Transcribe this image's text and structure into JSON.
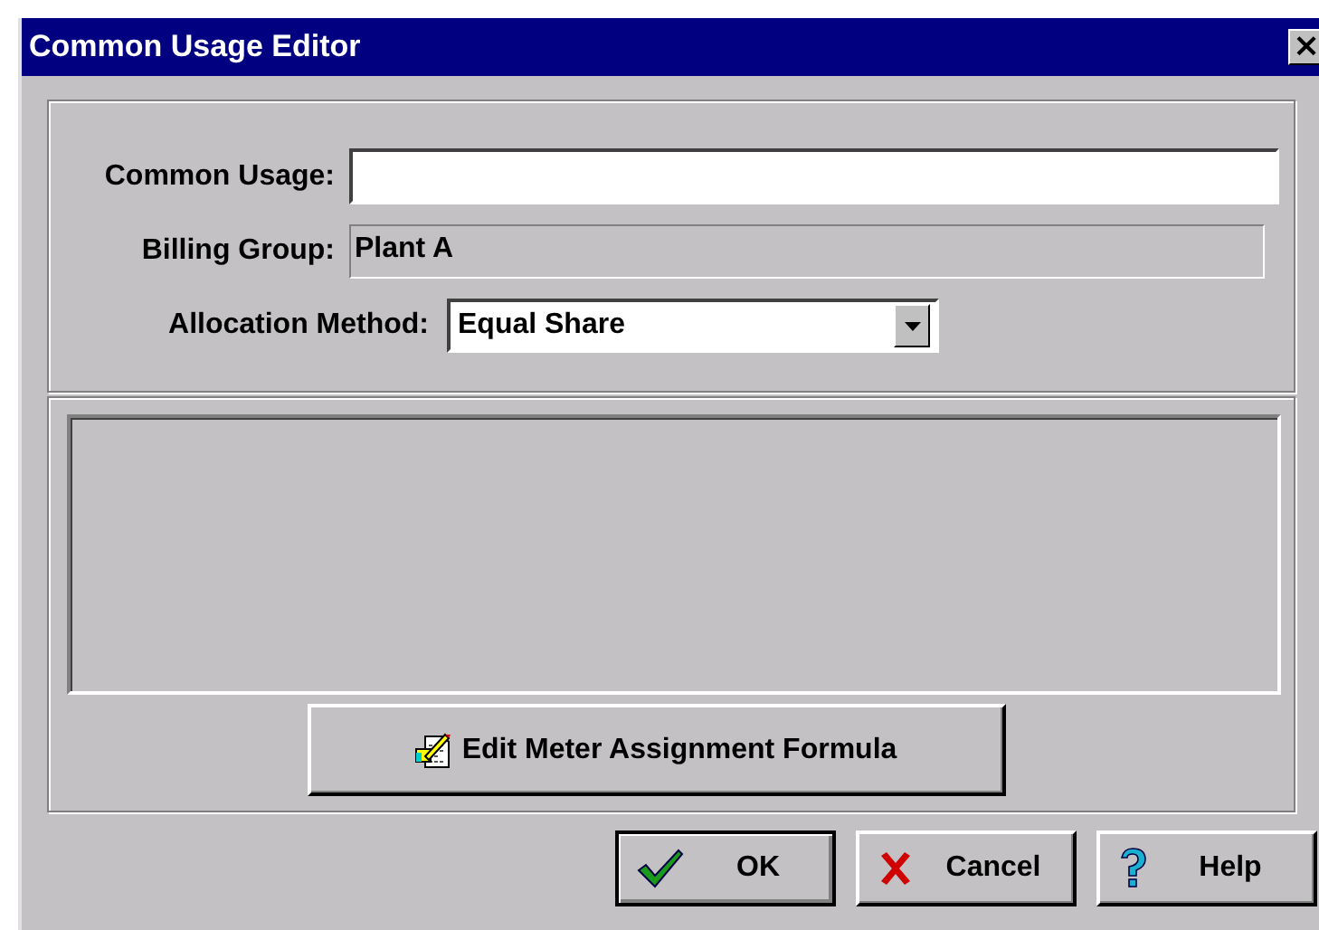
{
  "window": {
    "title": "Common Usage Editor",
    "close": "×"
  },
  "fields": [
    {
      "kind": "input",
      "label": "Common Usage:"
    },
    {
      "kind": "readonly",
      "label": "Billing Group:",
      "value": "Plant A"
    },
    {
      "kind": "dropdown",
      "label": "Allocation Method:",
      "value": "Equal Share"
    }
  ],
  "formula_button": "Edit Meter Assignment Formula",
  "buttons": [
    {
      "kind": "ok",
      "label": "OK"
    },
    {
      "kind": "cancel",
      "label": "Cancel"
    },
    {
      "kind": "help",
      "label": "Help"
    }
  ]
}
